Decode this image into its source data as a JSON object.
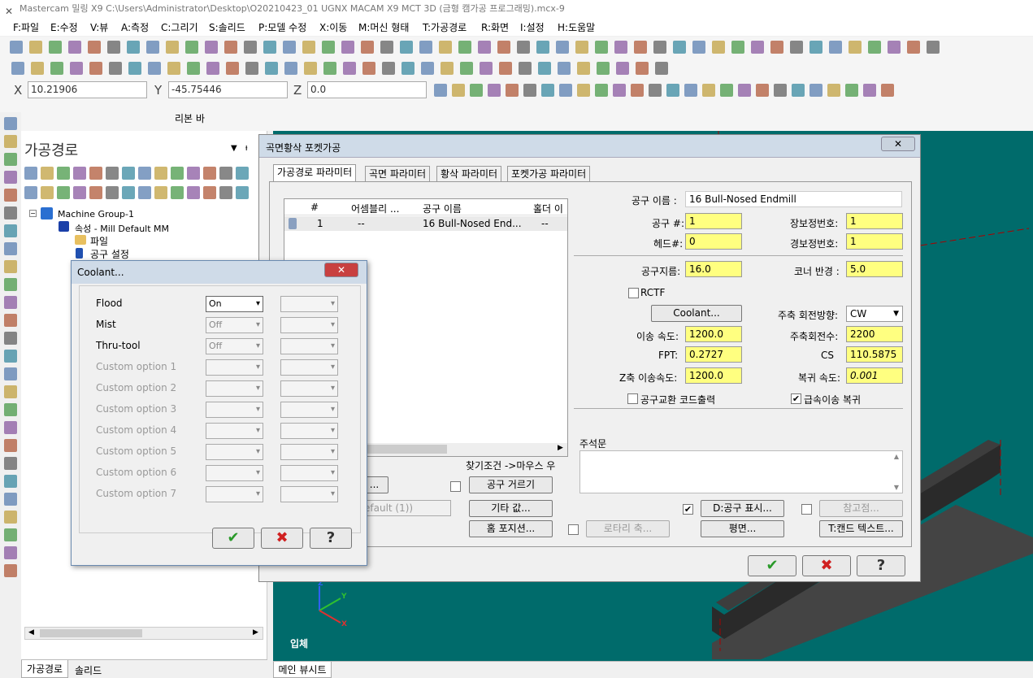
{
  "app": {
    "title": "Mastercam 밀링 X9  C:\\Users\\Administrator\\Desktop\\O20210423_01 UGNX MACAM X9 MCT 3D (금형 캠가공 프로그래밍).mcx-9"
  },
  "menu": [
    "F:파일",
    "E:수정",
    "V:뷰",
    "A:측정",
    "C:그리기",
    "S:솔리드",
    "P:모델 수정",
    "X:이동",
    "M:머신 형태",
    "T:가공경로",
    "R:화면",
    "I:설정",
    "H:도움말"
  ],
  "coords": {
    "x_label": "X",
    "x_value": "10.21906",
    "y_label": "Y",
    "y_value": "-45.75446",
    "z_label": "Z",
    "z_value": "0.0"
  },
  "ribbon": {
    "label": "리본 바"
  },
  "toolpath_panel": {
    "title": "가공경로",
    "pin": "ᵼ",
    "tree": {
      "group": "Machine Group-1",
      "props": "속성 - Mill Default MM",
      "file": "파일",
      "tool_settings": "공구 설정"
    }
  },
  "bottom_tabs": [
    "가공경로",
    "솔리드"
  ],
  "viewport": {
    "view_label": "입체",
    "axes": {
      "z": "Z",
      "y": "Y",
      "x": "X"
    }
  },
  "status_tab": "메인 뷰시트",
  "dialog": {
    "title": "곡면황삭 포켓가공",
    "close": "✕",
    "tabs": [
      "가공경로 파라미터",
      "곡면 파라미터",
      "황삭 파라미터",
      "포켓가공 파라미터"
    ],
    "tool_table": {
      "columns": [
        "#",
        "어셈블리 ...",
        "공구 이름",
        "홀더 이"
      ],
      "rows": [
        [
          "1",
          "--",
          "16 Bull-Nosed End...",
          "--"
        ]
      ]
    },
    "tool_name_label": "공구 이름 :",
    "tool_name": "16 Bull-Nosed Endmill",
    "fields": {
      "tool_num_label": "공구 #:",
      "tool_num": "1",
      "len_off_label": "장보정번호:",
      "len_off": "1",
      "head_label": "헤드#:",
      "head": "0",
      "dia_off_label": "경보정번호:",
      "dia_off": "1",
      "dia_label": "공구지름:",
      "dia": "16.0",
      "corner_label": "코너 반경 :",
      "corner": "5.0",
      "rctf_label": "RCTF",
      "coolant_btn": "Coolant...",
      "spindle_dir_label": "주축 회전방향:",
      "spindle_dir": "CW",
      "feed_label": "이송 속도:",
      "feed": "1200.0",
      "rpm_label": "주축회전수:",
      "rpm": "2200",
      "fpt_label": "FPT:",
      "fpt": "0.2727",
      "cs_label": "CS",
      "cs": "110.5875",
      "zfeed_label": "Z축 이송속도:",
      "zfeed": "1200.0",
      "retract_label": "복귀 속도:",
      "retract": "0.001",
      "toolchange_label": "공구교환 코드출력",
      "rapid_label": "급속이송 복귀"
    },
    "comment_label": "주석문",
    "search_label": "찾기조건 ->마우스 우",
    "filter_btn": "공구 거르기",
    "default_field": "efault (1))",
    "other_values_btn": "기타 값...",
    "home_btn": "홈 포지션...",
    "rotary_btn": "로타리 축...",
    "show_tool_btn": "D:공구 표시...",
    "plane_btn": "평면...",
    "ref_btn": "참고점...",
    "canned_btn": "T:캔드 텍스트...",
    "ok": "✔",
    "cancel": "✖",
    "help": "?"
  },
  "coolant": {
    "title": "Coolant...",
    "close": "✕",
    "options": [
      {
        "label": "Flood",
        "value": "On"
      },
      {
        "label": "Mist",
        "value": "Off"
      },
      {
        "label": "Thru-tool",
        "value": "Off"
      },
      {
        "label": "Custom option 1",
        "value": ""
      },
      {
        "label": "Custom option 2",
        "value": ""
      },
      {
        "label": "Custom option 3",
        "value": ""
      },
      {
        "label": "Custom option 4",
        "value": ""
      },
      {
        "label": "Custom option 5",
        "value": ""
      },
      {
        "label": "Custom option 6",
        "value": ""
      },
      {
        "label": "Custom option 7",
        "value": ""
      }
    ],
    "ok": "✔",
    "cancel": "✖",
    "help": "?"
  },
  "colors": {
    "viewport": "#006b6b",
    "field_yellow": "#ffff80",
    "ok_green": "#2a9a2a",
    "cancel_red": "#d02020"
  }
}
